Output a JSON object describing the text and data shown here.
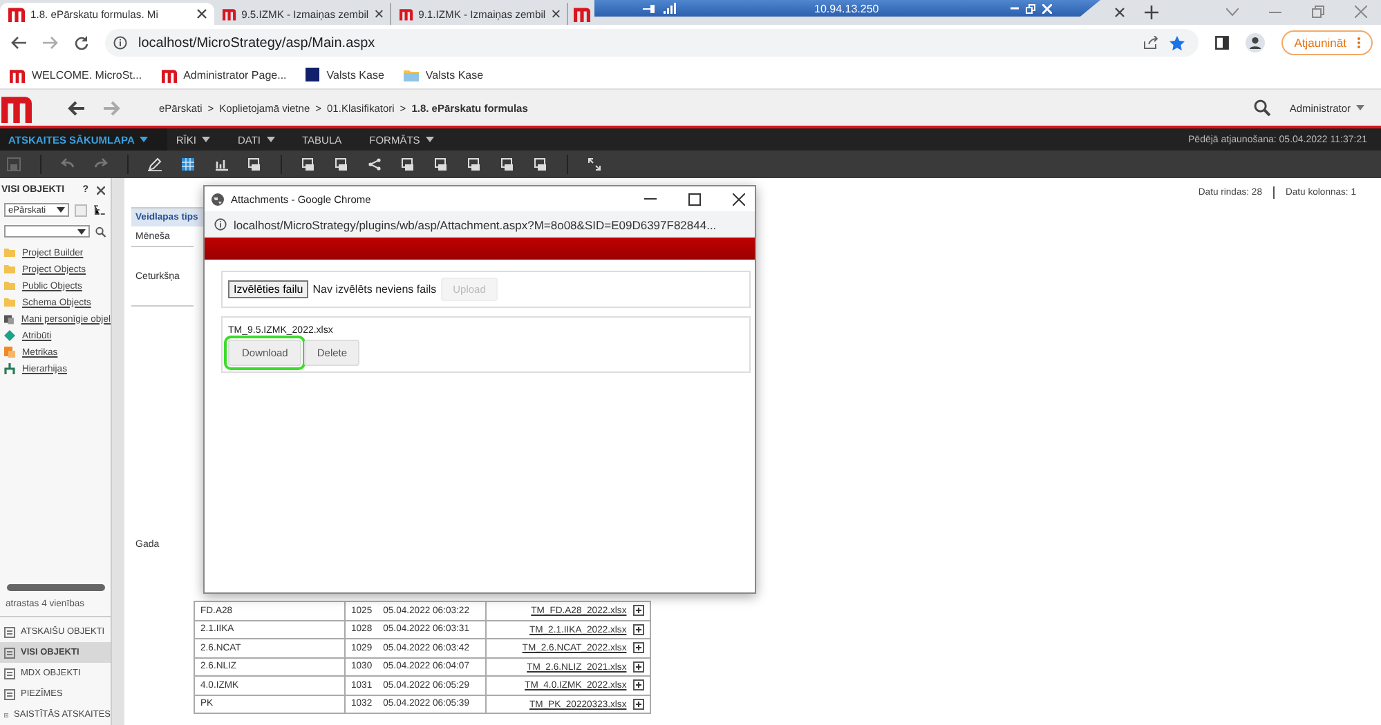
{
  "browser": {
    "tabs": [
      {
        "title": "1.8. ePārskatu formulas. Mi",
        "selected": true
      },
      {
        "title": "9.5.IZMK - Izmaiņas zembil",
        "selected": false
      },
      {
        "title": "9.1.IZMK - Izmaiņas zembil",
        "selected": false
      }
    ],
    "remote_host": "10.94.13.250",
    "address": "localhost/MicroStrategy/asp/Main.aspx",
    "update_button": "Atjaunināt",
    "bookmarks": [
      {
        "label": "WELCOME. MicroSt...",
        "kind": "logo"
      },
      {
        "label": "Administrator Page...",
        "kind": "logo"
      },
      {
        "label": "Valsts Kase",
        "kind": "square"
      },
      {
        "label": "Valsts Kase",
        "kind": "folder"
      }
    ]
  },
  "app": {
    "breadcrumb": [
      "ePārskati",
      "Koplietojamā vietne",
      "01.Klasifikatori",
      "1.8. ePārskatu formulas"
    ],
    "breadcrumb_separator": ">",
    "user": "Administrator",
    "menu": [
      {
        "label": "ATSKAITES SĀKUMLAPA",
        "selected": true,
        "dropdown": true
      },
      {
        "label": "RĪKI",
        "selected": false,
        "dropdown": true
      },
      {
        "label": "DATI",
        "selected": false,
        "dropdown": true
      },
      {
        "label": "TABULA",
        "selected": false,
        "dropdown": false
      },
      {
        "label": "FORMĀTS",
        "selected": false,
        "dropdown": true
      }
    ],
    "last_update": "Pēdējā atjaunošana: 05.04.2022 11:37:21"
  },
  "sidebar": {
    "title": "VISI OBJEKTI",
    "help": "?",
    "project": "ePārskati",
    "items": [
      {
        "label": "Project Builder",
        "kind": "folder"
      },
      {
        "label": "Project Objects",
        "kind": "folder"
      },
      {
        "label": "Public Objects",
        "kind": "folder"
      },
      {
        "label": "Schema Objects",
        "kind": "folder"
      },
      {
        "label": "Mani personīgie objel",
        "kind": "personal"
      },
      {
        "label": "Atribūti",
        "kind": "attribute"
      },
      {
        "label": "Metrikas",
        "kind": "metric"
      },
      {
        "label": "Hierarhijas",
        "kind": "hierarchy"
      }
    ],
    "found": "atrastas 4 vienības",
    "nav": [
      {
        "label": "ATSKAIŠU OBJEKTI",
        "selected": false
      },
      {
        "label": "VISI OBJEKTI",
        "selected": true
      },
      {
        "label": "MDX OBJEKTI",
        "selected": false
      },
      {
        "label": "PIEZĪMES",
        "selected": false
      },
      {
        "label": "SAISTĪTĀS ATSKAITES",
        "selected": false
      }
    ]
  },
  "report": {
    "rows_info": "Datu rindas: 28",
    "cols_info": "Datu kolonnas: 1",
    "header": "Veidlapas tips",
    "types": [
      "Mēneša",
      "Ceturkšņa",
      "Gada"
    ],
    "rows": [
      {
        "name": "FD.A28",
        "id": "1025",
        "date": "05.04.2022 06:03:22",
        "file": "TM_FD.A28_2022.xlsx"
      },
      {
        "name": "2.1.IIKA",
        "id": "1028",
        "date": "05.04.2022 06:03:31",
        "file": "TM_2.1.IIKA_2022.xlsx"
      },
      {
        "name": "2.6.NCAT",
        "id": "1029",
        "date": "05.04.2022 06:03:42",
        "file": "TM_2.6.NCAT_2022.xlsx"
      },
      {
        "name": "2.6.NLIZ",
        "id": "1030",
        "date": "05.04.2022 06:04:07",
        "file": "TM_2.6.NLIZ_2021.xlsx"
      },
      {
        "name": "4.0.IZMK",
        "id": "1031",
        "date": "05.04.2022 06:05:29",
        "file": "TM_4.0.IZMK_2022.xlsx"
      },
      {
        "name": "PK",
        "id": "1032",
        "date": "05.04.2022 06:05:39",
        "file": "TM_PK_20220323.xlsx"
      }
    ]
  },
  "dialog": {
    "title": "Attachments - Google Chrome",
    "url": "localhost/MicroStrategy/plugins/wb/asp/Attachment.aspx?M=8o08&SID=E09D6397F82844...",
    "choose_button": "Izvēlēties failu",
    "no_file": "Nav izvēlēts neviens fails",
    "upload_button": "Upload",
    "upload_disabled": true,
    "file": "TM_9.5.IZMK_2022.xlsx",
    "download_button": "Download",
    "download_focused": true,
    "delete_button": "Delete"
  }
}
